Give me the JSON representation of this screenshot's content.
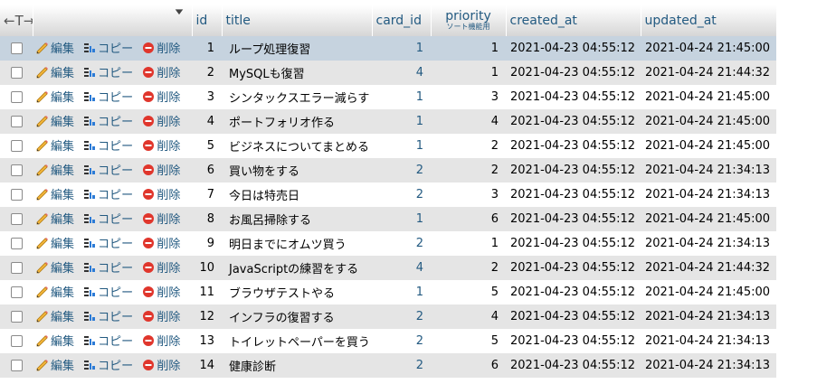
{
  "header": {
    "nav_arrows": "←T→",
    "columns": {
      "id": "id",
      "title": "title",
      "card_id": "card_id",
      "priority": "priority",
      "priority_sub": "ソート機能用",
      "created_at": "created_at",
      "updated_at": "updated_at"
    }
  },
  "actions": {
    "edit": "編集",
    "copy": "コピー",
    "delete": "削除"
  },
  "icons": {
    "edit": "pencil-icon",
    "copy": "copy-icon",
    "delete": "delete-icon",
    "sort": "sort-triangle-icon"
  },
  "colors": {
    "link": "#235a81",
    "row_even": "#e5e5e5",
    "row_highlight": "#c6d3df",
    "delete_red": "#e0362c"
  },
  "rows": [
    {
      "id": "1",
      "title": "ループ処理復習",
      "card_id": "1",
      "priority": "1",
      "created_at": "2021-04-23 04:55:12",
      "updated_at": "2021-04-24 21:45:00"
    },
    {
      "id": "2",
      "title": "MySQLも復習",
      "card_id": "4",
      "priority": "1",
      "created_at": "2021-04-23 04:55:12",
      "updated_at": "2021-04-24 21:44:32"
    },
    {
      "id": "3",
      "title": "シンタックスエラー減らす",
      "card_id": "1",
      "priority": "3",
      "created_at": "2021-04-23 04:55:12",
      "updated_at": "2021-04-24 21:45:00"
    },
    {
      "id": "4",
      "title": "ポートフォリオ作る",
      "card_id": "1",
      "priority": "4",
      "created_at": "2021-04-23 04:55:12",
      "updated_at": "2021-04-24 21:45:00"
    },
    {
      "id": "5",
      "title": "ビジネスについてまとめる",
      "card_id": "1",
      "priority": "2",
      "created_at": "2021-04-23 04:55:12",
      "updated_at": "2021-04-24 21:45:00"
    },
    {
      "id": "6",
      "title": "買い物をする",
      "card_id": "2",
      "priority": "2",
      "created_at": "2021-04-23 04:55:12",
      "updated_at": "2021-04-24 21:34:13"
    },
    {
      "id": "7",
      "title": "今日は特売日",
      "card_id": "2",
      "priority": "3",
      "created_at": "2021-04-23 04:55:12",
      "updated_at": "2021-04-24 21:34:13"
    },
    {
      "id": "8",
      "title": "お風呂掃除する",
      "card_id": "1",
      "priority": "6",
      "created_at": "2021-04-23 04:55:12",
      "updated_at": "2021-04-24 21:45:00"
    },
    {
      "id": "9",
      "title": "明日までにオムツ買う",
      "card_id": "2",
      "priority": "1",
      "created_at": "2021-04-23 04:55:12",
      "updated_at": "2021-04-24 21:34:13"
    },
    {
      "id": "10",
      "title": "JavaScriptの練習をする",
      "card_id": "4",
      "priority": "2",
      "created_at": "2021-04-23 04:55:12",
      "updated_at": "2021-04-24 21:44:32"
    },
    {
      "id": "11",
      "title": "ブラウザテストやる",
      "card_id": "1",
      "priority": "5",
      "created_at": "2021-04-23 04:55:12",
      "updated_at": "2021-04-24 21:45:00"
    },
    {
      "id": "12",
      "title": "インフラの復習する",
      "card_id": "2",
      "priority": "4",
      "created_at": "2021-04-23 04:55:12",
      "updated_at": "2021-04-24 21:34:13"
    },
    {
      "id": "13",
      "title": "トイレットペーパーを買う",
      "card_id": "2",
      "priority": "5",
      "created_at": "2021-04-23 04:55:12",
      "updated_at": "2021-04-24 21:34:13"
    },
    {
      "id": "14",
      "title": "健康診断",
      "card_id": "2",
      "priority": "6",
      "created_at": "2021-04-23 04:55:12",
      "updated_at": "2021-04-24 21:34:13"
    }
  ]
}
